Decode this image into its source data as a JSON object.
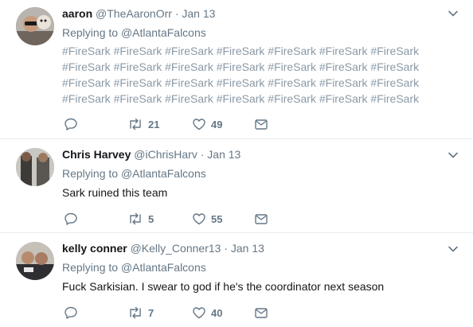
{
  "tweets": [
    {
      "name": "aaron",
      "handle": "@TheAaronOrr",
      "dot": "·",
      "time": "Jan 13",
      "replying_label": "Replying to",
      "replying_to": "@AtlantaFalcons",
      "text": "#FireSark #FireSark #FireSark #FireSark #FireSark #FireSark #FireSark #FireSark #FireSark #FireSark #FireSark #FireSark #FireSark #FireSark #FireSark #FireSark #FireSark #FireSark #FireSark #FireSark #FireSark #FireSark #FireSark #FireSark #FireSark #FireSark #FireSark #FireSark",
      "replies": "",
      "retweets": "21",
      "likes": "49"
    },
    {
      "name": "Chris Harvey",
      "handle": "@iChrisHarv",
      "dot": "·",
      "time": "Jan 13",
      "replying_label": "Replying to",
      "replying_to": "@AtlantaFalcons",
      "text": "Sark ruined this team",
      "replies": "",
      "retweets": "5",
      "likes": "55"
    },
    {
      "name": "kelly conner",
      "handle": "@Kelly_Conner13",
      "dot": "·",
      "time": "Jan 13",
      "replying_label": "Replying to",
      "replying_to": "@AtlantaFalcons",
      "text": "Fuck Sarkisian. I swear to god if he's the coordinator next season",
      "replies": "",
      "retweets": "7",
      "likes": "40"
    }
  ],
  "colors": {
    "text": "#14171a",
    "muted": "#657786",
    "divider": "#e6ecf0",
    "hashtag": "#8a99a6"
  },
  "icons": [
    "reply-icon",
    "retweet-icon",
    "like-icon",
    "message-icon",
    "chevron-down-icon"
  ]
}
